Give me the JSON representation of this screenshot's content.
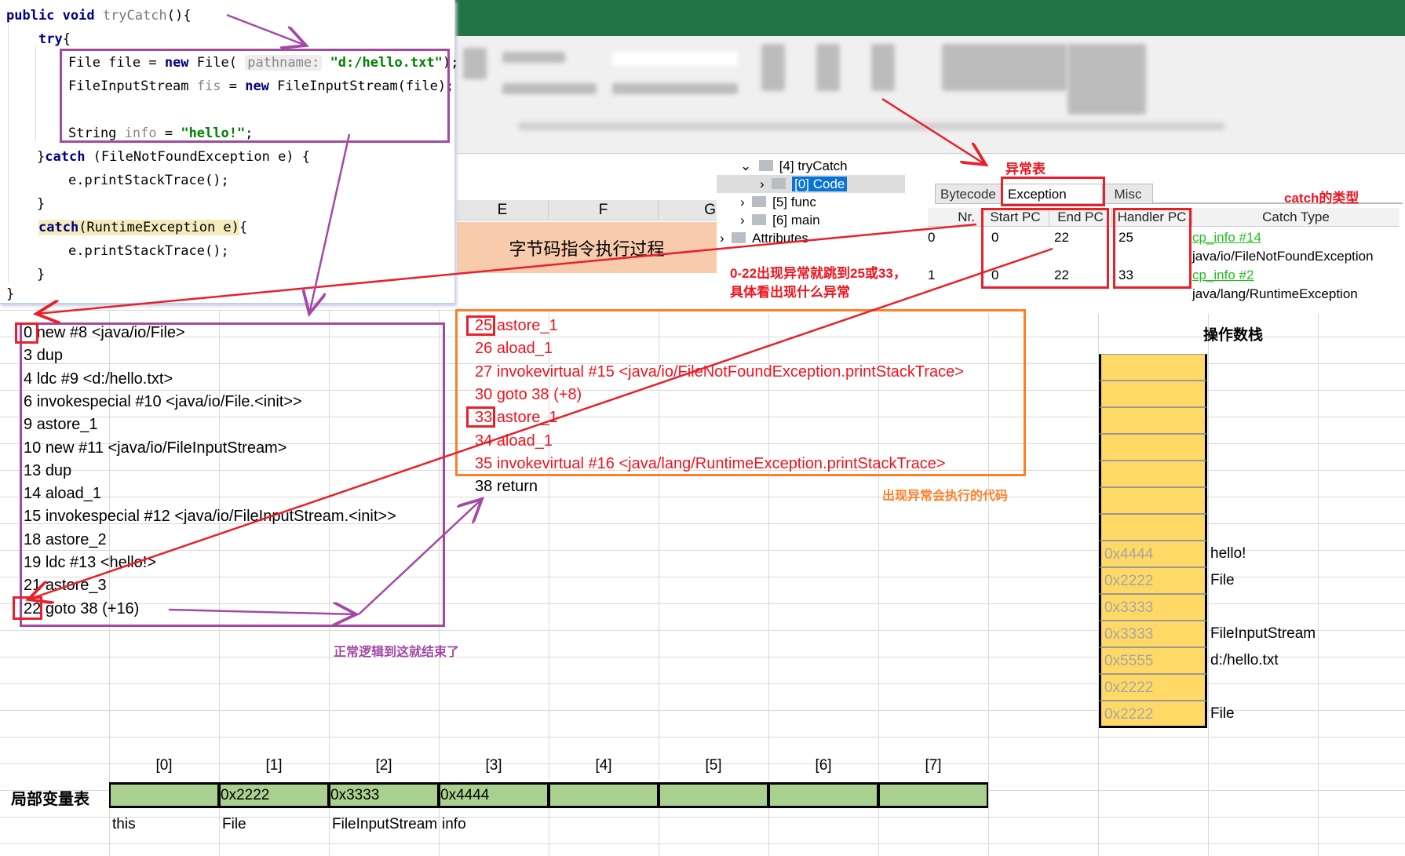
{
  "code": {
    "lines": [
      [
        {
          "t": "public void ",
          "c": "kw"
        },
        {
          "t": "tryCatch",
          "c": "fn"
        },
        {
          "t": "(){",
          "c": ""
        }
      ],
      [
        {
          "t": "try",
          "c": "kw"
        },
        {
          "t": "{",
          "c": ""
        }
      ],
      [
        {
          "t": "File file = ",
          "c": ""
        },
        {
          "t": "new",
          "c": "kw"
        },
        {
          "t": " File( ",
          "c": ""
        },
        {
          "t": "pathname:",
          "c": "hint"
        },
        {
          "t": " \"d:/hello.txt\"",
          "c": "str"
        },
        {
          "t": ");",
          "c": ""
        }
      ],
      [
        {
          "t": "FileInputStream ",
          "c": ""
        },
        {
          "t": "fis",
          "c": "var"
        },
        {
          "t": " = ",
          "c": ""
        },
        {
          "t": "new",
          "c": "kw"
        },
        {
          "t": " FileInputStream(file);",
          "c": ""
        }
      ],
      [
        {
          "t": "String ",
          "c": ""
        },
        {
          "t": "info",
          "c": "var"
        },
        {
          "t": " = ",
          "c": ""
        },
        {
          "t": "\"hello!\"",
          "c": "str"
        },
        {
          "t": ";",
          "c": ""
        }
      ],
      [
        {
          "t": "}",
          "c": ""
        },
        {
          "t": "catch",
          "c": "kw"
        },
        {
          "t": " (FileNotFoundException e) {",
          "c": ""
        }
      ],
      [
        {
          "t": "e.printStackTrace();",
          "c": ""
        }
      ],
      [
        {
          "t": "}",
          "c": ""
        }
      ],
      [
        {
          "t": "catch",
          "c": "kw hl"
        },
        {
          "t": "(RuntimeException e)",
          "c": "hl"
        },
        {
          "t": "{",
          "c": ""
        }
      ],
      [
        {
          "t": "e.printStackTrace();",
          "c": ""
        }
      ],
      [
        {
          "t": "}",
          "c": ""
        }
      ],
      [
        {
          "t": "}",
          "c": ""
        }
      ]
    ]
  },
  "sheet": {
    "columns": [
      "E",
      "F",
      "G"
    ],
    "title_cell": "字节码指令执行过程"
  },
  "tree": {
    "items": [
      {
        "label": "[4] tryCatch",
        "expanded": true
      },
      {
        "label": "[0] Code",
        "selected": true
      },
      {
        "label": "[5] func"
      },
      {
        "label": "[6] main"
      },
      {
        "label": "Attributes"
      }
    ]
  },
  "exception_table": {
    "tabs": [
      "Bytecode",
      "Exception table",
      "Misc"
    ],
    "active_tab": "Exception table",
    "headers": [
      "Nr.",
      "Start PC",
      "End PC",
      "Handler PC",
      "Catch Type"
    ],
    "rows": [
      {
        "nr": "0",
        "start": "0",
        "end": "22",
        "handler": "25",
        "cp": "cp_info #14",
        "type": "java/io/FileNotFoundException"
      },
      {
        "nr": "1",
        "start": "0",
        "end": "22",
        "handler": "33",
        "cp": "cp_info #2",
        "type": "java/lang/RuntimeException"
      }
    ]
  },
  "annotations": {
    "exception_table_label": "异常表",
    "catch_type_label": "catch的类型",
    "range_note_1": "0-22出现异常就跳到25或33，",
    "range_note_2": "具体看出现什么异常",
    "handler_note": "出现异常会执行的代码",
    "normal_note": "正常逻辑到这就结束了"
  },
  "bytecode": {
    "main": [
      {
        "pc": "0",
        "op": "new #8 <java/io/File>"
      },
      {
        "pc": "3",
        "op": "dup"
      },
      {
        "pc": "4",
        "op": "ldc #9 <d:/hello.txt>"
      },
      {
        "pc": "6",
        "op": "invokespecial #10 <java/io/File.<init>>"
      },
      {
        "pc": "9",
        "op": "astore_1"
      },
      {
        "pc": "10",
        "op": "new #11 <java/io/FileInputStream>"
      },
      {
        "pc": "13",
        "op": "dup"
      },
      {
        "pc": "14",
        "op": "aload_1"
      },
      {
        "pc": "15",
        "op": "invokespecial #12 <java/io/FileInputStream.<init>>"
      },
      {
        "pc": "18",
        "op": "astore_2"
      },
      {
        "pc": "19",
        "op": "ldc #13 <hello!>"
      },
      {
        "pc": "21",
        "op": "astore_3"
      },
      {
        "pc": "22",
        "op": "goto 38 (+16)"
      }
    ],
    "handlers": [
      {
        "pc": "25",
        "op": "astore_1"
      },
      {
        "pc": "26",
        "op": "aload_1"
      },
      {
        "pc": "27",
        "op": "invokevirtual #15 <java/io/FileNotFoundException.printStackTrace>"
      },
      {
        "pc": "30",
        "op": "goto 38 (+8)"
      },
      {
        "pc": "33",
        "op": "astore_1"
      },
      {
        "pc": "34",
        "op": "aload_1"
      },
      {
        "pc": "35",
        "op": "invokevirtual #16 <java/lang/RuntimeException.printStackTrace>"
      }
    ],
    "return_line": {
      "pc": "38",
      "op": "return"
    }
  },
  "operand_stack": {
    "title": "操作数栈",
    "cells": [
      {
        "value": "",
        "label": ""
      },
      {
        "value": "",
        "label": ""
      },
      {
        "value": "",
        "label": ""
      },
      {
        "value": "",
        "label": ""
      },
      {
        "value": "",
        "label": ""
      },
      {
        "value": "",
        "label": ""
      },
      {
        "value": "",
        "label": ""
      },
      {
        "value": "0x4444",
        "label": "hello!"
      },
      {
        "value": "0x2222",
        "label": "File"
      },
      {
        "value": "0x3333",
        "label": ""
      },
      {
        "value": "0x3333",
        "label": "FileInputStream"
      },
      {
        "value": "0x5555",
        "label": "d:/hello.txt"
      },
      {
        "value": "0x2222",
        "label": ""
      },
      {
        "value": "0x2222",
        "label": "File"
      }
    ]
  },
  "local_vars": {
    "title": "局部变量表",
    "slots": [
      {
        "index": "[0]",
        "value": "",
        "name": "this"
      },
      {
        "index": "[1]",
        "value": "0x2222",
        "name": "File"
      },
      {
        "index": "[2]",
        "value": "0x3333",
        "name": "FileInputStream"
      },
      {
        "index": "[3]",
        "value": "0x4444",
        "name": "info"
      },
      {
        "index": "[4]",
        "value": "",
        "name": ""
      },
      {
        "index": "[5]",
        "value": "",
        "name": ""
      },
      {
        "index": "[6]",
        "value": "",
        "name": ""
      },
      {
        "index": "[7]",
        "value": "",
        "name": ""
      }
    ]
  },
  "colors": {
    "excel_green": "#217346",
    "slot_green": "#a9d08e",
    "stack_yellow": "#ffd966",
    "purple": "#a349a4",
    "red": "#e8202a",
    "orange": "#ff7f27",
    "peach": "#f8cbad"
  }
}
